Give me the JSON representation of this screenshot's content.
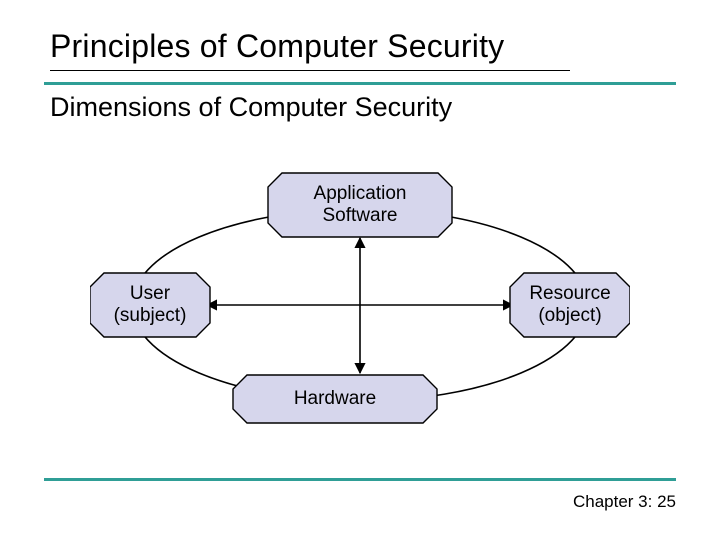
{
  "title": "Principles of Computer Security",
  "subtitle": "Dimensions of Computer Security",
  "footer": "Chapter 3: 25",
  "diagram": {
    "nodes": {
      "top": {
        "line1": "Application",
        "line2": "Software"
      },
      "left": {
        "line1": "User",
        "line2": "(subject)"
      },
      "right": {
        "line1": "Resource",
        "line2": "(object)"
      },
      "bottom": {
        "line1": "Hardware",
        "line2": ""
      }
    },
    "colors": {
      "node_fill": "#d6d6ec",
      "node_stroke": "#000000",
      "ellipse_stroke": "#000000",
      "arrow": "#000000"
    }
  }
}
